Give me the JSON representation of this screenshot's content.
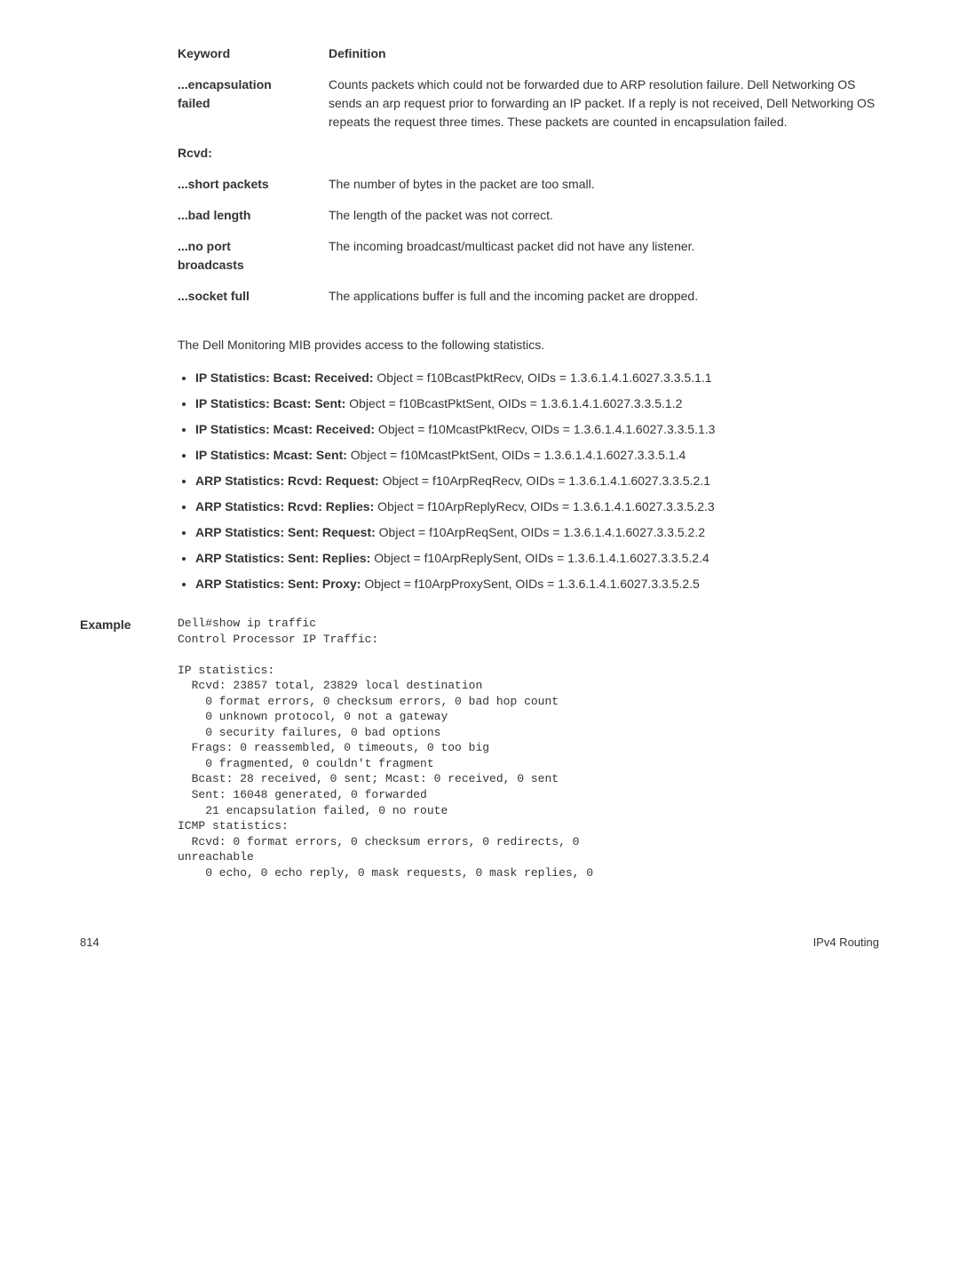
{
  "table": {
    "header_keyword": "Keyword",
    "header_def": "Definition",
    "rows": [
      {
        "keyword": "...encapsulation failed",
        "def": "Counts packets which could not be forwarded due to ARP resolution failure. Dell Networking OS sends an arp request prior to forwarding an IP packet. If a reply is not received, Dell Networking OS repeats the request three times. These packets are counted in encapsulation failed."
      },
      {
        "keyword": "Rcvd:",
        "def": ""
      },
      {
        "keyword": "...short packets",
        "def": "The number of bytes in the packet are too small."
      },
      {
        "keyword": "...bad length",
        "def": "The length of the packet was not correct."
      },
      {
        "keyword": "...no port broadcasts",
        "def": "The incoming broadcast/multicast packet did not have any listener."
      },
      {
        "keyword": "...socket full",
        "def": "The applications buffer is full and the incoming packet are dropped."
      }
    ]
  },
  "intro": "The Dell Monitoring MIB provides access to the following statistics.",
  "bullets": [
    {
      "b": "IP Statistics: Bcast: Received:",
      "t": " Object = f10BcastPktRecv, OIDs = 1.3.6.1.4.1.6027.3.3.5.1.1"
    },
    {
      "b": "IP Statistics: Bcast: Sent:",
      "t": " Object = f10BcastPktSent, OIDs = 1.3.6.1.4.1.6027.3.3.5.1.2"
    },
    {
      "b": "IP Statistics: Mcast: Received:",
      "t": " Object = f10McastPktRecv, OIDs = 1.3.6.1.4.1.6027.3.3.5.1.3"
    },
    {
      "b": "IP Statistics: Mcast: Sent:",
      "t": " Object = f10McastPktSent, OIDs = 1.3.6.1.4.1.6027.3.3.5.1.4"
    },
    {
      "b": "ARP Statistics: Rcvd: Request:",
      "t": " Object = f10ArpReqRecv, OIDs = 1.3.6.1.4.1.6027.3.3.5.2.1"
    },
    {
      "b": "ARP Statistics: Rcvd: Replies:",
      "t": " Object = f10ArpReplyRecv, OIDs = 1.3.6.1.4.1.6027.3.3.5.2.3"
    },
    {
      "b": "ARP Statistics: Sent: Request:",
      "t": " Object = f10ArpReqSent, OIDs = 1.3.6.1.4.1.6027.3.3.5.2.2"
    },
    {
      "b": "ARP Statistics: Sent: Replies:",
      "t": " Object = f10ArpReplySent, OIDs = 1.3.6.1.4.1.6027.3.3.5.2.4"
    },
    {
      "b": "ARP Statistics: Sent: Proxy:",
      "t": " Object = f10ArpProxySent, OIDs = 1.3.6.1.4.1.6027.3.3.5.2.5"
    }
  ],
  "example_label": "Example",
  "code": "Dell#show ip traffic\nControl Processor IP Traffic:\n\nIP statistics:\n  Rcvd: 23857 total, 23829 local destination\n    0 format errors, 0 checksum errors, 0 bad hop count\n    0 unknown protocol, 0 not a gateway\n    0 security failures, 0 bad options\n  Frags: 0 reassembled, 0 timeouts, 0 too big\n    0 fragmented, 0 couldn't fragment\n  Bcast: 28 received, 0 sent; Mcast: 0 received, 0 sent\n  Sent: 16048 generated, 0 forwarded\n    21 encapsulation failed, 0 no route\nICMP statistics:\n  Rcvd: 0 format errors, 0 checksum errors, 0 redirects, 0 \nunreachable\n    0 echo, 0 echo reply, 0 mask requests, 0 mask replies, 0 ",
  "footer": {
    "page": "814",
    "section": "IPv4 Routing"
  }
}
